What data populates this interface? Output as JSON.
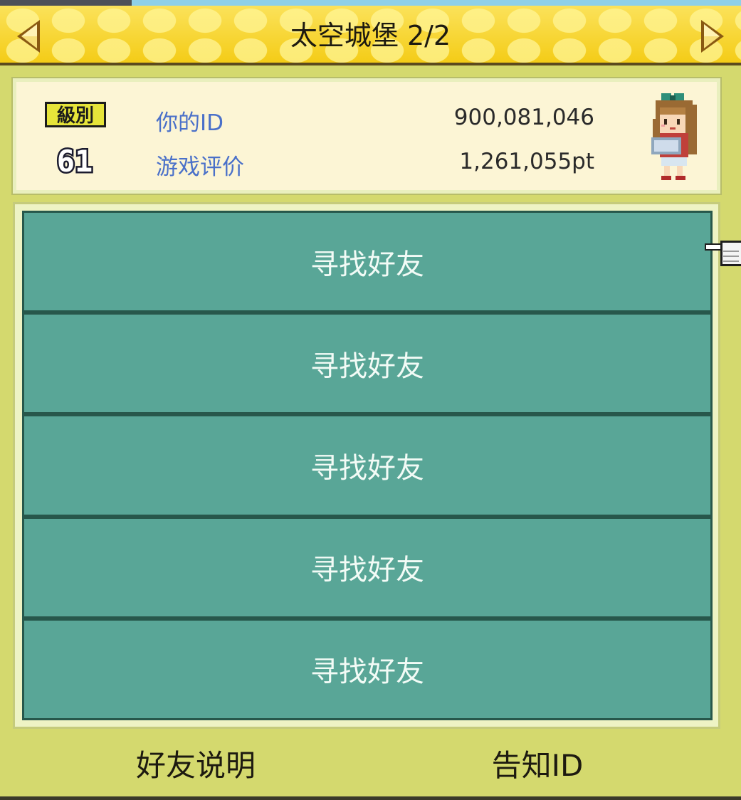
{
  "header": {
    "title": "太空城堡 2/2",
    "prev_icon": "chevron-left-icon",
    "next_icon": "chevron-right-icon"
  },
  "player": {
    "level_badge": "級別",
    "level": "61",
    "id_label": "你的ID",
    "id_value": "900,081,046",
    "rating_label": "游戏评价",
    "rating_value": "1,261,055pt",
    "avatar_icon": "player-avatar-icon"
  },
  "friend_slots": [
    {
      "label": "寻找好友"
    },
    {
      "label": "寻找好友"
    },
    {
      "label": "寻找好友"
    },
    {
      "label": "寻找好友"
    },
    {
      "label": "寻找好友"
    }
  ],
  "cursor_icon": "pointing-hand-icon",
  "footer": {
    "help_label": "好友说明",
    "share_id_label": "告知ID"
  },
  "colors": {
    "header_yellow": "#f6d21a",
    "background": "#d4d96e",
    "slot_teal": "#59a697",
    "slot_border": "#27574b",
    "label_blue": "#4a70c9"
  }
}
